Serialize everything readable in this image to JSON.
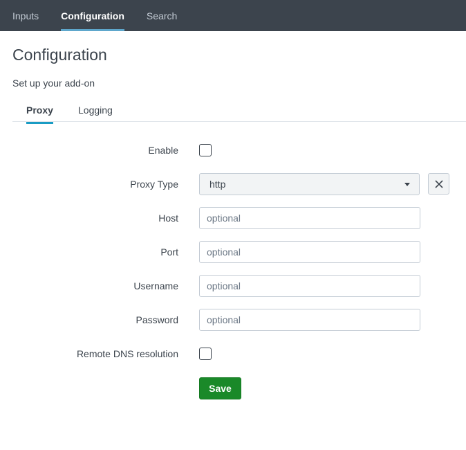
{
  "topnav": {
    "items": [
      {
        "label": "Inputs",
        "active": false
      },
      {
        "label": "Configuration",
        "active": true
      },
      {
        "label": "Search",
        "active": false
      }
    ]
  },
  "page": {
    "title": "Configuration",
    "subtitle": "Set up your add-on"
  },
  "tabs": [
    {
      "label": "Proxy",
      "active": true
    },
    {
      "label": "Logging",
      "active": false
    }
  ],
  "form": {
    "enable": {
      "label": "Enable",
      "checked": false
    },
    "proxy_type": {
      "label": "Proxy Type",
      "value": "http"
    },
    "host": {
      "label": "Host",
      "placeholder": "optional",
      "value": ""
    },
    "port": {
      "label": "Port",
      "placeholder": "optional",
      "value": ""
    },
    "username": {
      "label": "Username",
      "placeholder": "optional",
      "value": ""
    },
    "password": {
      "label": "Password",
      "placeholder": "optional",
      "value": ""
    },
    "remote_dns": {
      "label": "Remote DNS resolution",
      "checked": false
    },
    "save_label": "Save"
  },
  "colors": {
    "topnav_bg": "#3c444d",
    "active_tab_underline": "#1a9cc4",
    "save_button": "#1a8929"
  }
}
